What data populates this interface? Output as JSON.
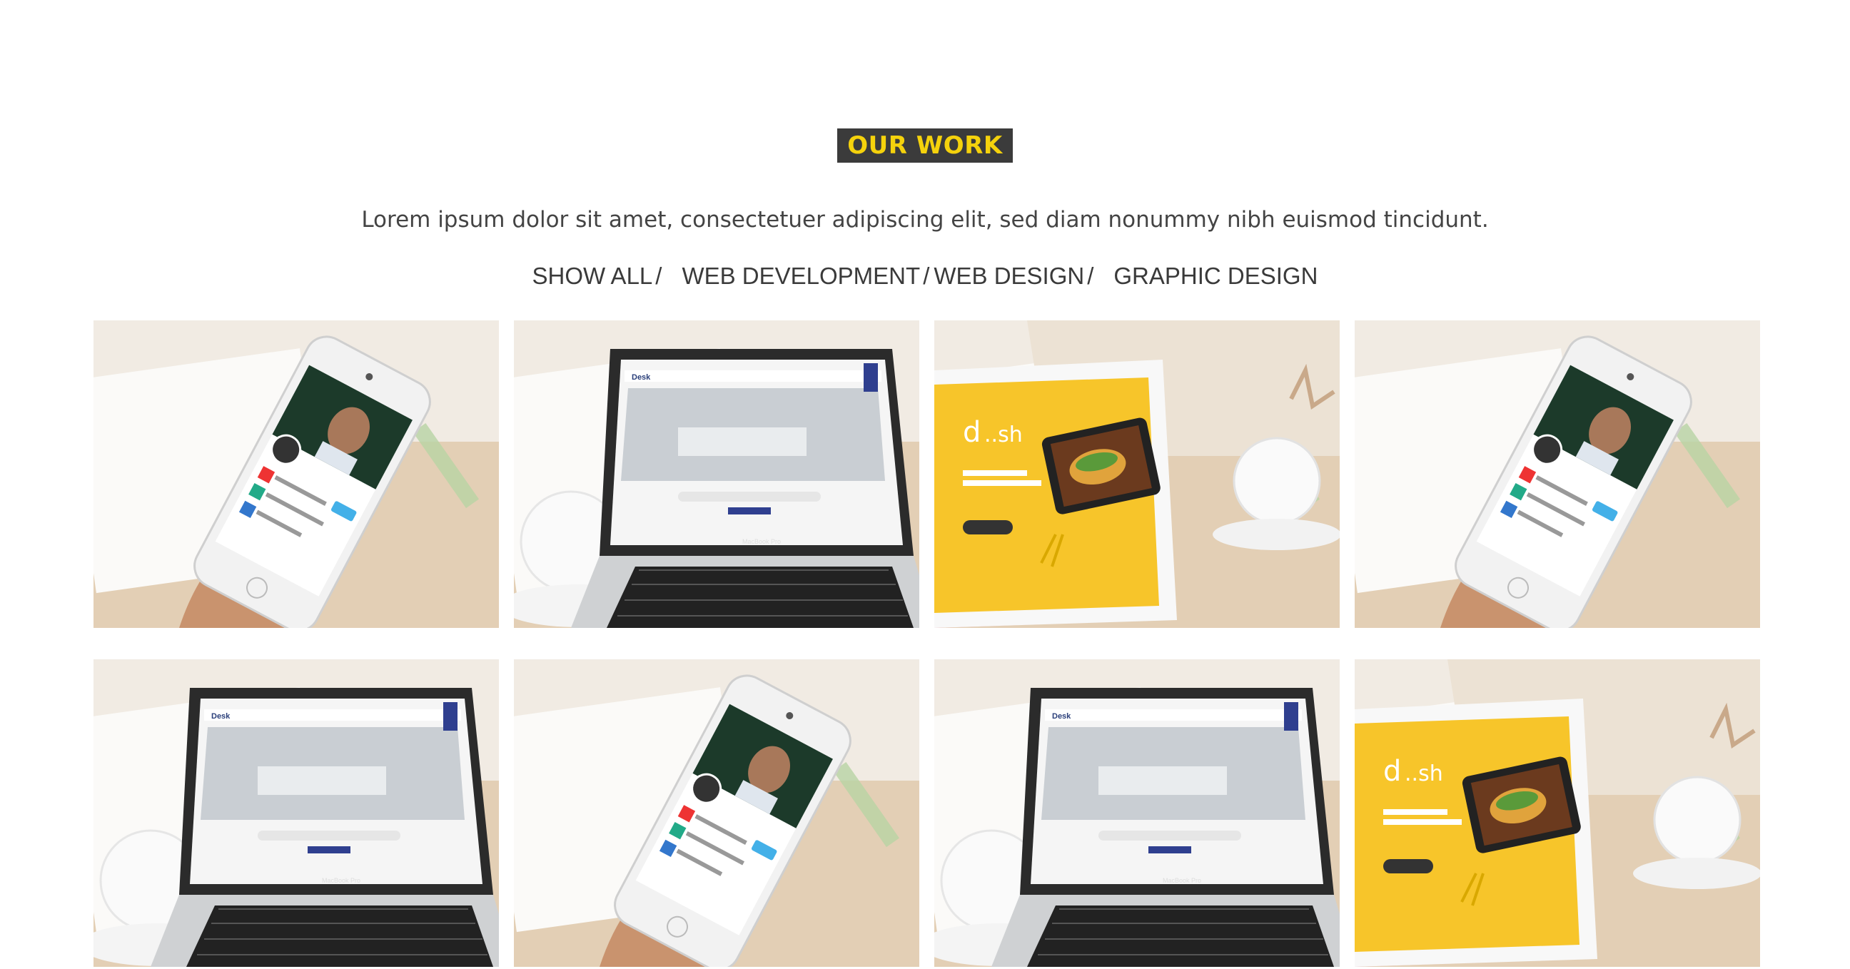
{
  "section": {
    "title": "OUR WORK",
    "subtitle": "Lorem ipsum dolor sit amet, consectetuer adipiscing elit, sed diam nonummy nibh euismod tincidunt."
  },
  "filters": [
    {
      "label": "SHOW ALL"
    },
    {
      "label": "WEB DEVELOPMENT"
    },
    {
      "label": "WEB DESIGN"
    },
    {
      "label": "GRAPHIC DESIGN"
    }
  ],
  "separator": "/",
  "colors": {
    "title_bg": "#3b3b3b",
    "title_text": "#f5d20c",
    "dish_yellow": "#f7c52a"
  },
  "portfolio": {
    "items": [
      {
        "type": "phone",
        "icon": "phone-mockup"
      },
      {
        "type": "laptop",
        "icon": "laptop-mockup",
        "site_logo": "Deskbookers",
        "device_label": "MacBook Pro"
      },
      {
        "type": "tablet",
        "icon": "tablet-mockup",
        "site_logo": "dish"
      },
      {
        "type": "phone",
        "icon": "phone-mockup"
      },
      {
        "type": "laptop",
        "icon": "laptop-mockup",
        "site_logo": "Deskbookers",
        "device_label": "MacBook Pro"
      },
      {
        "type": "phone",
        "icon": "phone-mockup"
      },
      {
        "type": "laptop",
        "icon": "laptop-mockup",
        "site_logo": "Deskbookers",
        "device_label": "MacBook Pro"
      },
      {
        "type": "tablet",
        "icon": "tablet-mockup",
        "site_logo": "dish"
      }
    ]
  }
}
